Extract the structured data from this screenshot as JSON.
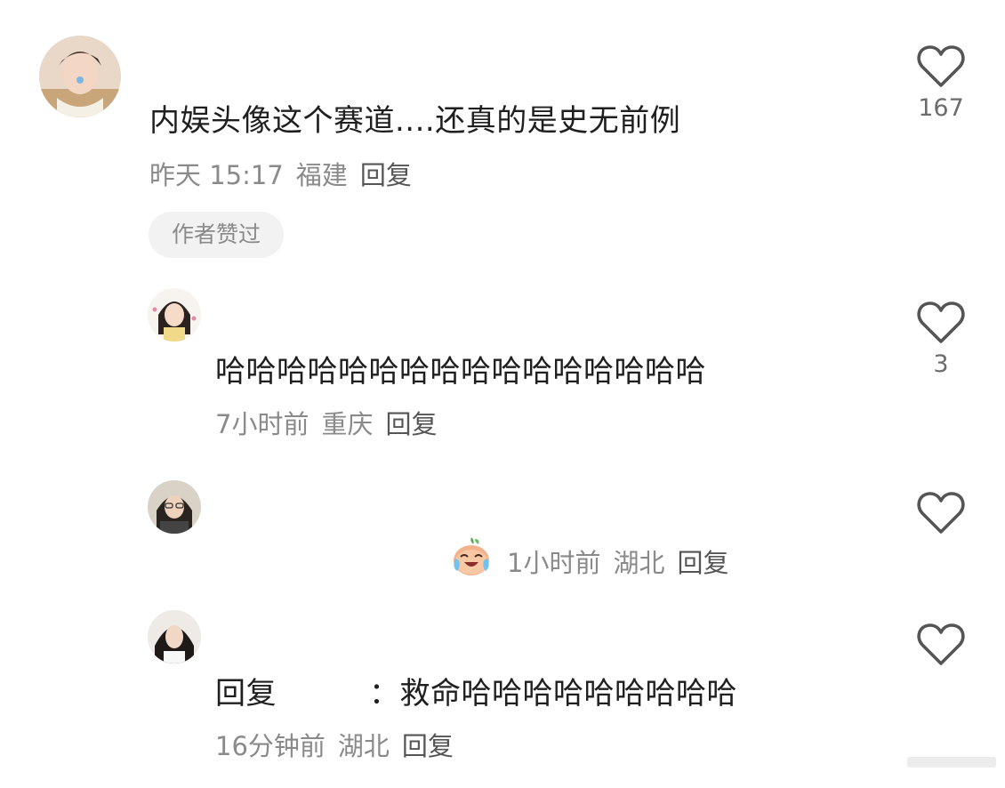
{
  "comments": [
    {
      "text": "内娱头像这个赛道....还真的是史无前例",
      "time": "昨天 15:17",
      "location": "福建",
      "reply_label": "回复",
      "badge": "作者赞过",
      "likes": "167",
      "avatar": "avatar-young-man"
    },
    {
      "text": "哈哈哈哈哈哈哈哈哈哈哈哈哈哈哈哈",
      "time": "7小时前",
      "location": "重庆",
      "reply_label": "回复",
      "likes": "3",
      "avatar": "avatar-cartoon-girl"
    },
    {
      "emoji": "crying-laughing-face-icon",
      "time": "1小时前",
      "location": "湖北",
      "reply_label": "回复",
      "likes": "",
      "avatar": "avatar-girl-glasses"
    },
    {
      "reply_prefix": "回复",
      "reply_separator": "：",
      "text": "救命哈哈哈哈哈哈哈哈哈",
      "time": "16分钟前",
      "location": "湖北",
      "reply_label": "回复",
      "likes": "",
      "avatar": "avatar-girl-dark-hair"
    }
  ],
  "icons": {
    "like": "heart-outline-icon"
  },
  "colors": {
    "meta_text": "#8a8a8a",
    "body_text": "#1f1f1f",
    "badge_bg": "#f2f2f2",
    "icon_stroke": "#555555"
  }
}
